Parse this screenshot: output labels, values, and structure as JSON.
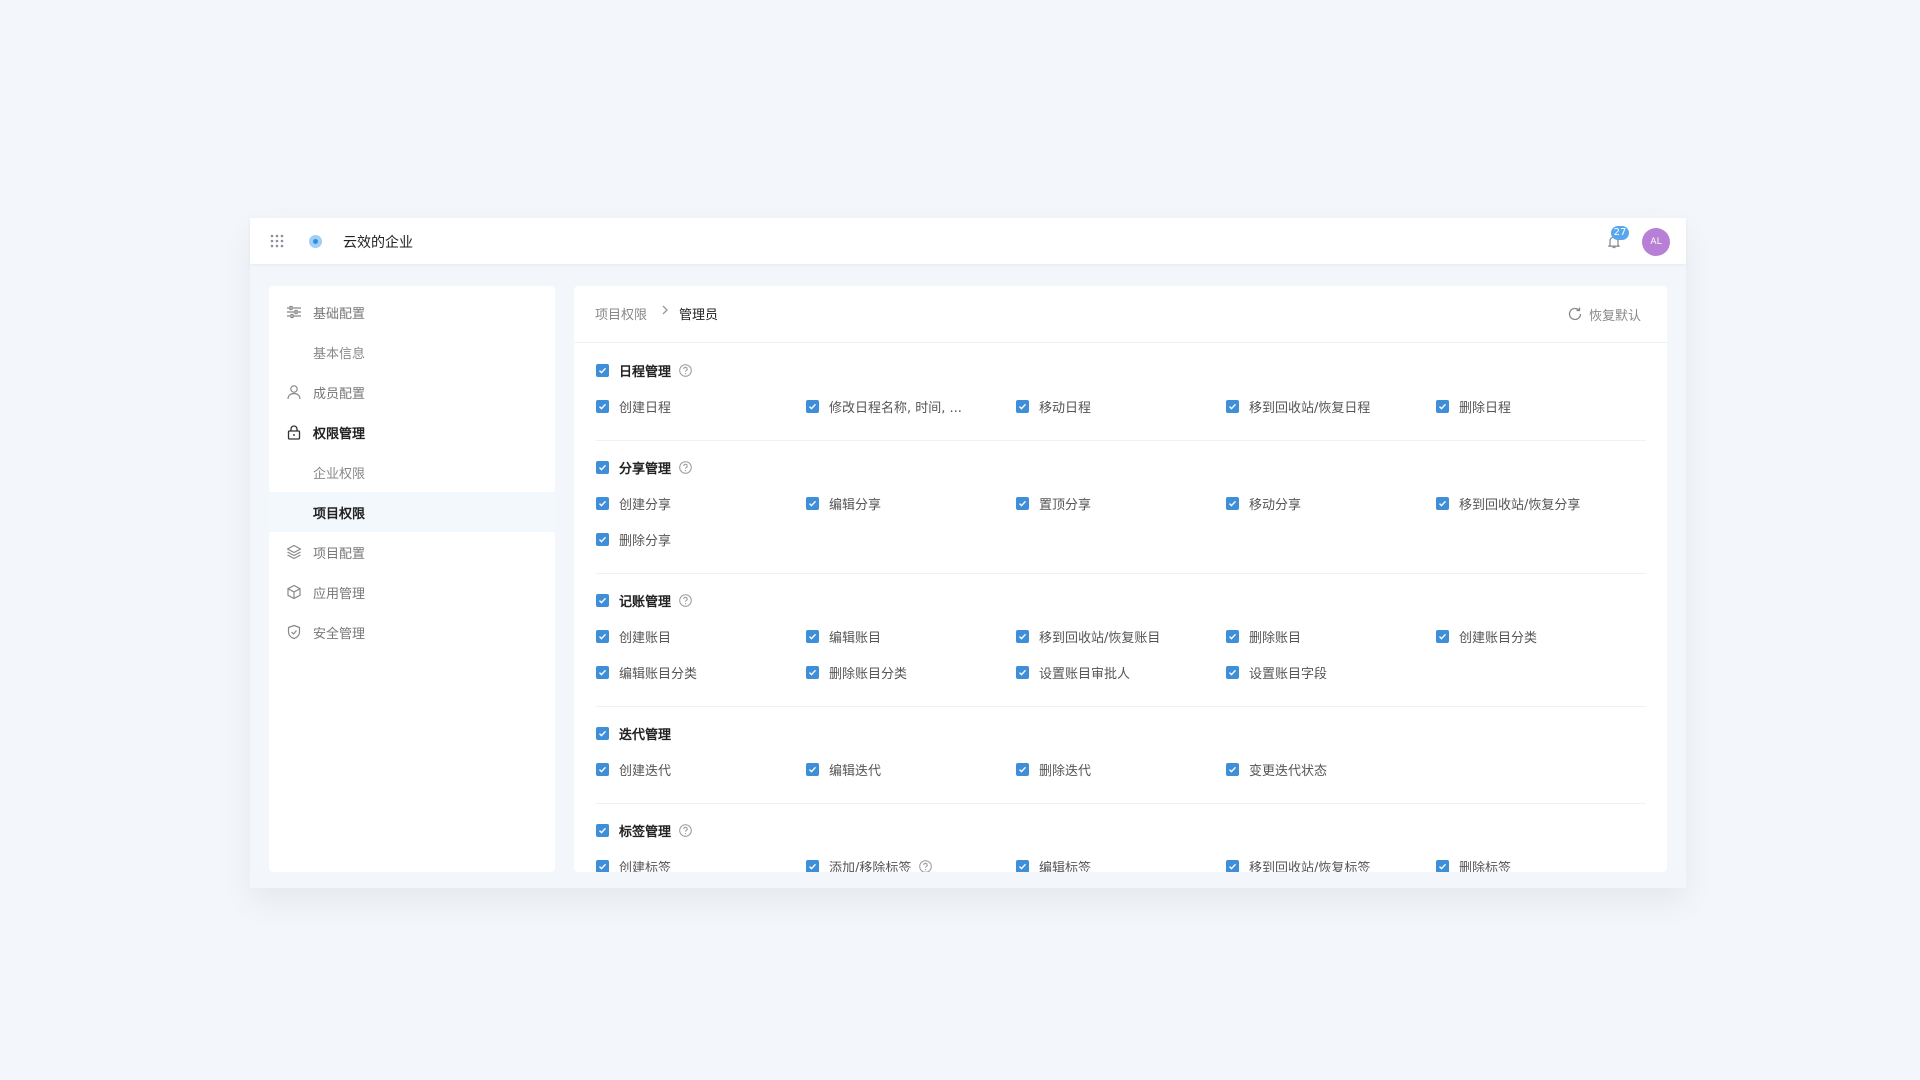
{
  "header": {
    "company_name": "云效的企业",
    "notification_count": "27",
    "avatar_initials": "AL"
  },
  "sidebar": {
    "items": [
      {
        "label": "基础配置",
        "icon": "sliders-icon"
      },
      {
        "label": "基本信息"
      },
      {
        "label": "成员配置",
        "icon": "user-icon"
      },
      {
        "label": "权限管理",
        "icon": "lock-icon"
      },
      {
        "label": "企业权限"
      },
      {
        "label": "项目权限"
      },
      {
        "label": "项目配置",
        "icon": "layers-icon"
      },
      {
        "label": "应用管理",
        "icon": "cube-icon"
      },
      {
        "label": "安全管理",
        "icon": "shield-icon"
      }
    ]
  },
  "breadcrumb": {
    "parent": "项目权限",
    "current": "管理员"
  },
  "restore_label": "恢复默认",
  "colors": {
    "accent": "#3f8ed8",
    "background": "#f3f6fa"
  },
  "sections": [
    {
      "title": "日程管理",
      "has_help": true,
      "permissions": [
        "创建日程",
        "修改日程名称, 时间, ...",
        "移动日程",
        "移到回收站/恢复日程",
        "删除日程"
      ]
    },
    {
      "title": "分享管理",
      "has_help": true,
      "permissions": [
        "创建分享",
        "编辑分享",
        "置顶分享",
        "移动分享",
        "移到回收站/恢复分享",
        "删除分享"
      ]
    },
    {
      "title": "记账管理",
      "has_help": true,
      "permissions": [
        "创建账目",
        "编辑账目",
        "移到回收站/恢复账目",
        "删除账目",
        "创建账目分类",
        "编辑账目分类",
        "删除账目分类",
        "设置账目审批人",
        "设置账目字段"
      ]
    },
    {
      "title": "迭代管理",
      "has_help": false,
      "permissions": [
        "创建迭代",
        "编辑迭代",
        "删除迭代",
        "变更迭代状态"
      ]
    },
    {
      "title": "标签管理",
      "has_help": true,
      "permissions": [
        "创建标签",
        "添加/移除标签",
        "编辑标签",
        "移到回收站/恢复标签",
        "删除标签"
      ]
    }
  ]
}
